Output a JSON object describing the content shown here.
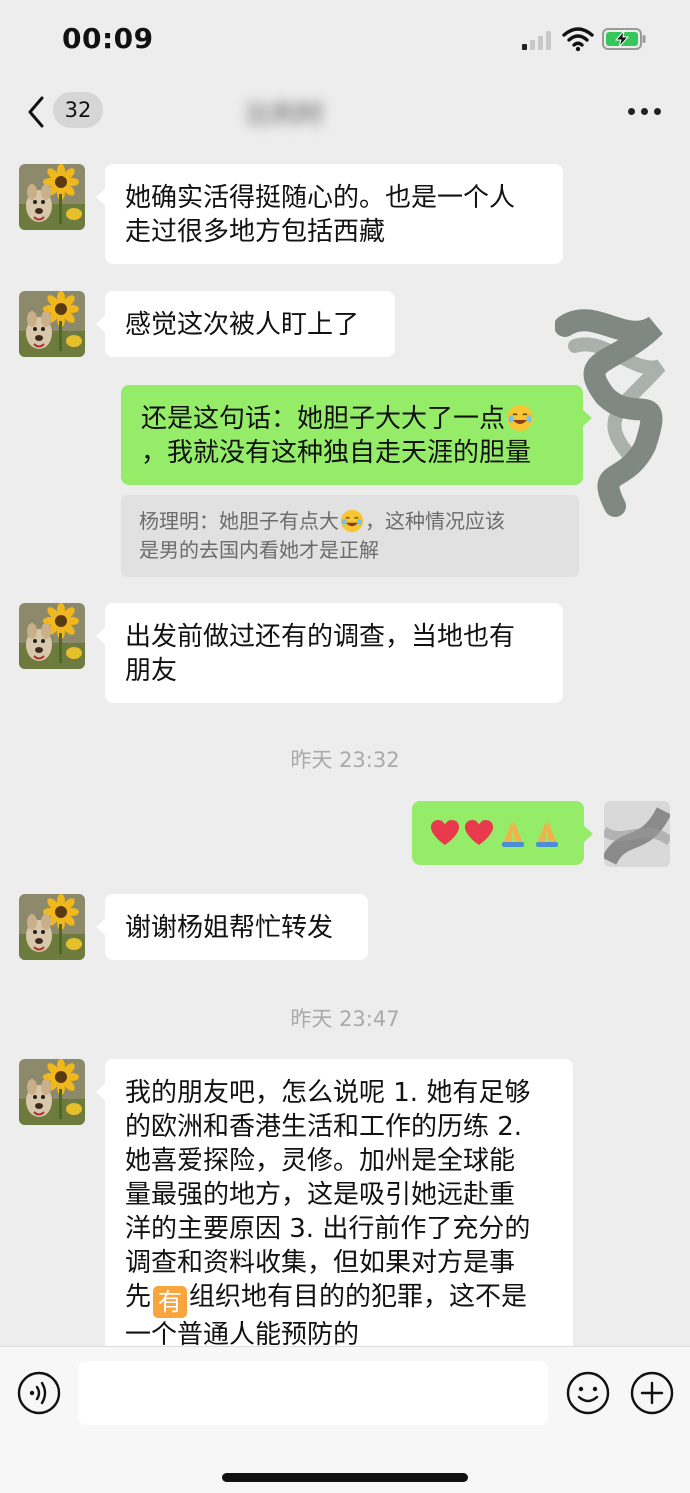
{
  "status_bar": {
    "time": "00:09",
    "icons": [
      "signal-icon",
      "wifi-icon",
      "battery-charging-icon"
    ]
  },
  "nav": {
    "back_icon": "chevron-left-icon",
    "unread_count": "32",
    "title": "比利时",
    "more_icon": "more-dots-icon"
  },
  "messages": [
    {
      "side": "left",
      "lines": [
        "她确实活得挺随心的。也是一个人",
        "走过很多地方包括西藏"
      ]
    },
    {
      "side": "left",
      "lines": [
        "感觉这次被人盯上了"
      ]
    },
    {
      "side": "right",
      "line1": "还是这句话：她胆子大大了一点",
      "line2": "，我就没有这种独自走天涯的胆量",
      "emoji": "laughing-tears-emoji"
    },
    {
      "side": "quote",
      "line1_a": "杨理明：她胆子有点大",
      "line1_b": "，这种情况应该",
      "line2": "是男的去国内看她才是正解",
      "emoji": "laughing-tears-emoji"
    },
    {
      "side": "left",
      "lines": [
        "出发前做过还有的调查，当地也有",
        "朋友"
      ]
    },
    {
      "side": "timestamp",
      "text": "昨天 23:32"
    },
    {
      "side": "right",
      "emojis": [
        "heart-emoji",
        "heart-emoji",
        "pray-emoji",
        "pray-emoji"
      ]
    },
    {
      "side": "left",
      "lines": [
        "谢谢杨姐帮忙转发"
      ]
    },
    {
      "side": "timestamp",
      "text": "昨天 23:47"
    },
    {
      "side": "left",
      "lines": [
        "我的朋友吧，怎么说呢 1. 她有足够",
        "的欧洲和香港生活和工作的历练 2.",
        "她喜爱探险，灵修。加州是全球能",
        "量最强的地方，这是吸引她远赴重",
        "洋的主要原因 3. 出行前作了充分的",
        "调查和资料收集，但如果对方是事"
      ],
      "line7_a": "先",
      "you_emoji": "有",
      "line7_b": "组织地有目的的犯罪，这不是",
      "line8": "一个普通人能预防的"
    }
  ],
  "input_bar": {
    "voice_icon": "voice-icon",
    "input_value": "",
    "sticker_icon": "sticker-icon",
    "plus_icon": "plus-icon"
  },
  "colors": {
    "background": "#ededed",
    "incoming_bubble": "#ffffff",
    "outgoing_bubble": "#95ec69",
    "quote_bg": "#e1e1e1",
    "timestamp": "#aaaaaa"
  }
}
